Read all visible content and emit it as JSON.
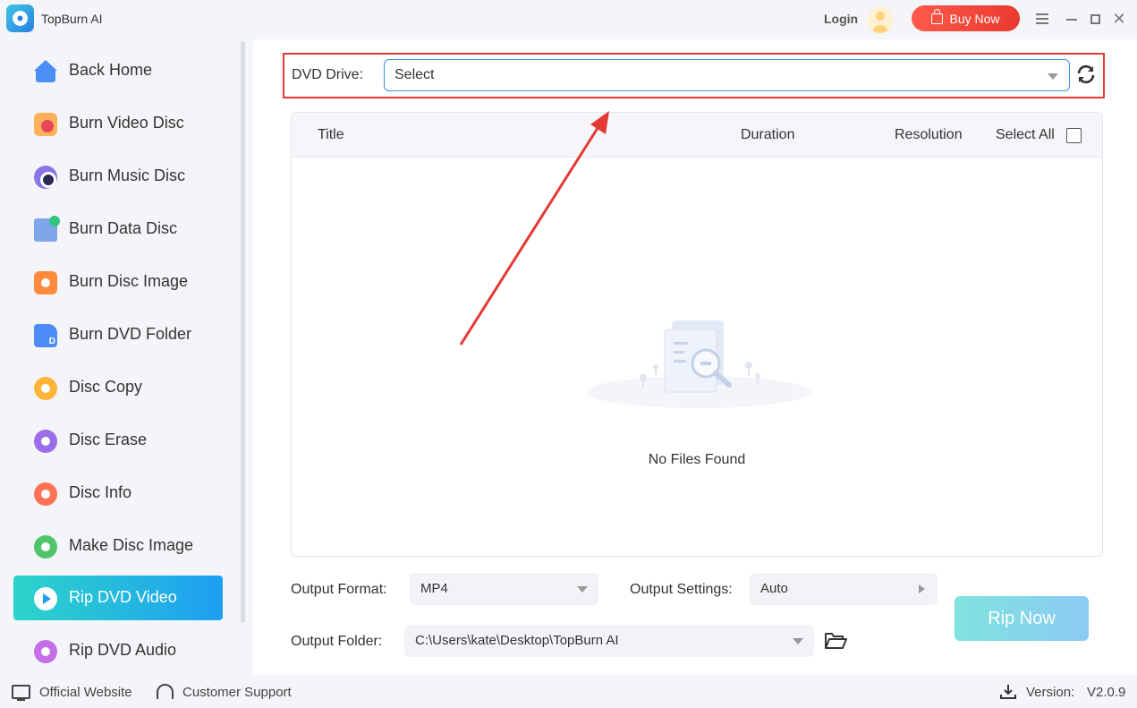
{
  "app": {
    "title": "TopBurn AI"
  },
  "header": {
    "login": "Login",
    "buy_now": "Buy Now"
  },
  "sidebar": {
    "items": [
      {
        "label": "Back Home",
        "icon": "home-icon"
      },
      {
        "label": "Burn Video Disc",
        "icon": "video-disc-icon"
      },
      {
        "label": "Burn Music Disc",
        "icon": "music-disc-icon"
      },
      {
        "label": "Burn Data Disc",
        "icon": "data-disc-icon"
      },
      {
        "label": "Burn Disc Image",
        "icon": "disc-image-icon"
      },
      {
        "label": "Burn DVD Folder",
        "icon": "dvd-folder-icon"
      },
      {
        "label": "Disc Copy",
        "icon": "disc-copy-icon"
      },
      {
        "label": "Disc Erase",
        "icon": "disc-erase-icon"
      },
      {
        "label": "Disc Info",
        "icon": "disc-info-icon"
      },
      {
        "label": "Make Disc Image",
        "icon": "make-disc-image-icon"
      },
      {
        "label": "Rip DVD Video",
        "icon": "rip-video-icon",
        "active": true
      },
      {
        "label": "Rip DVD Audio",
        "icon": "rip-audio-icon"
      }
    ]
  },
  "main": {
    "drive": {
      "label": "DVD Drive:",
      "value": "Select"
    },
    "table": {
      "columns": {
        "title": "Title",
        "duration": "Duration",
        "resolution": "Resolution",
        "select_all": "Select All"
      },
      "empty_text": "No Files Found"
    },
    "output": {
      "format_label": "Output Format:",
      "format_value": "MP4",
      "settings_label": "Output Settings:",
      "settings_value": "Auto",
      "folder_label": "Output Folder:",
      "folder_value": "C:\\Users\\kate\\Desktop\\TopBurn AI"
    },
    "rip_button": "Rip Now"
  },
  "footer": {
    "official_website": "Official Website",
    "customer_support": "Customer Support",
    "version_label": "Version:",
    "version_value": "V2.0.9"
  },
  "colors": {
    "accent_start": "#2dd4c9",
    "accent_end": "#1d9ff2",
    "buy_now": "#ff5a4b",
    "highlight_box": "#e53935"
  }
}
